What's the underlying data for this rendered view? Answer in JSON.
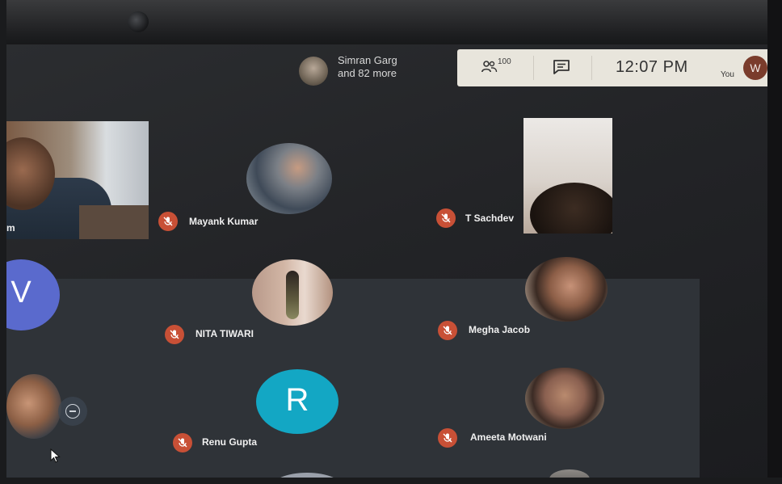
{
  "header": {
    "others_line1": "Simran Garg",
    "others_line2": "and 82 more",
    "people_count": "100",
    "clock": "12:07 PM",
    "you_label": "You",
    "you_initial": "W"
  },
  "participants": {
    "left_partial": "m",
    "mayank": "Mayank Kumar",
    "tsachdev": "T Sachdev",
    "v_initial": "V",
    "nita": "NITA TIWARI",
    "megha": "Megha Jacob",
    "r_initial": "R",
    "renu": "Renu Gupta",
    "ameeta": "Ameeta Motwani"
  },
  "colors": {
    "mic_muted": "#c85036",
    "v_avatar": "#5a6acd",
    "r_avatar": "#13a7c4",
    "you_avatar": "#7a3c2c"
  }
}
